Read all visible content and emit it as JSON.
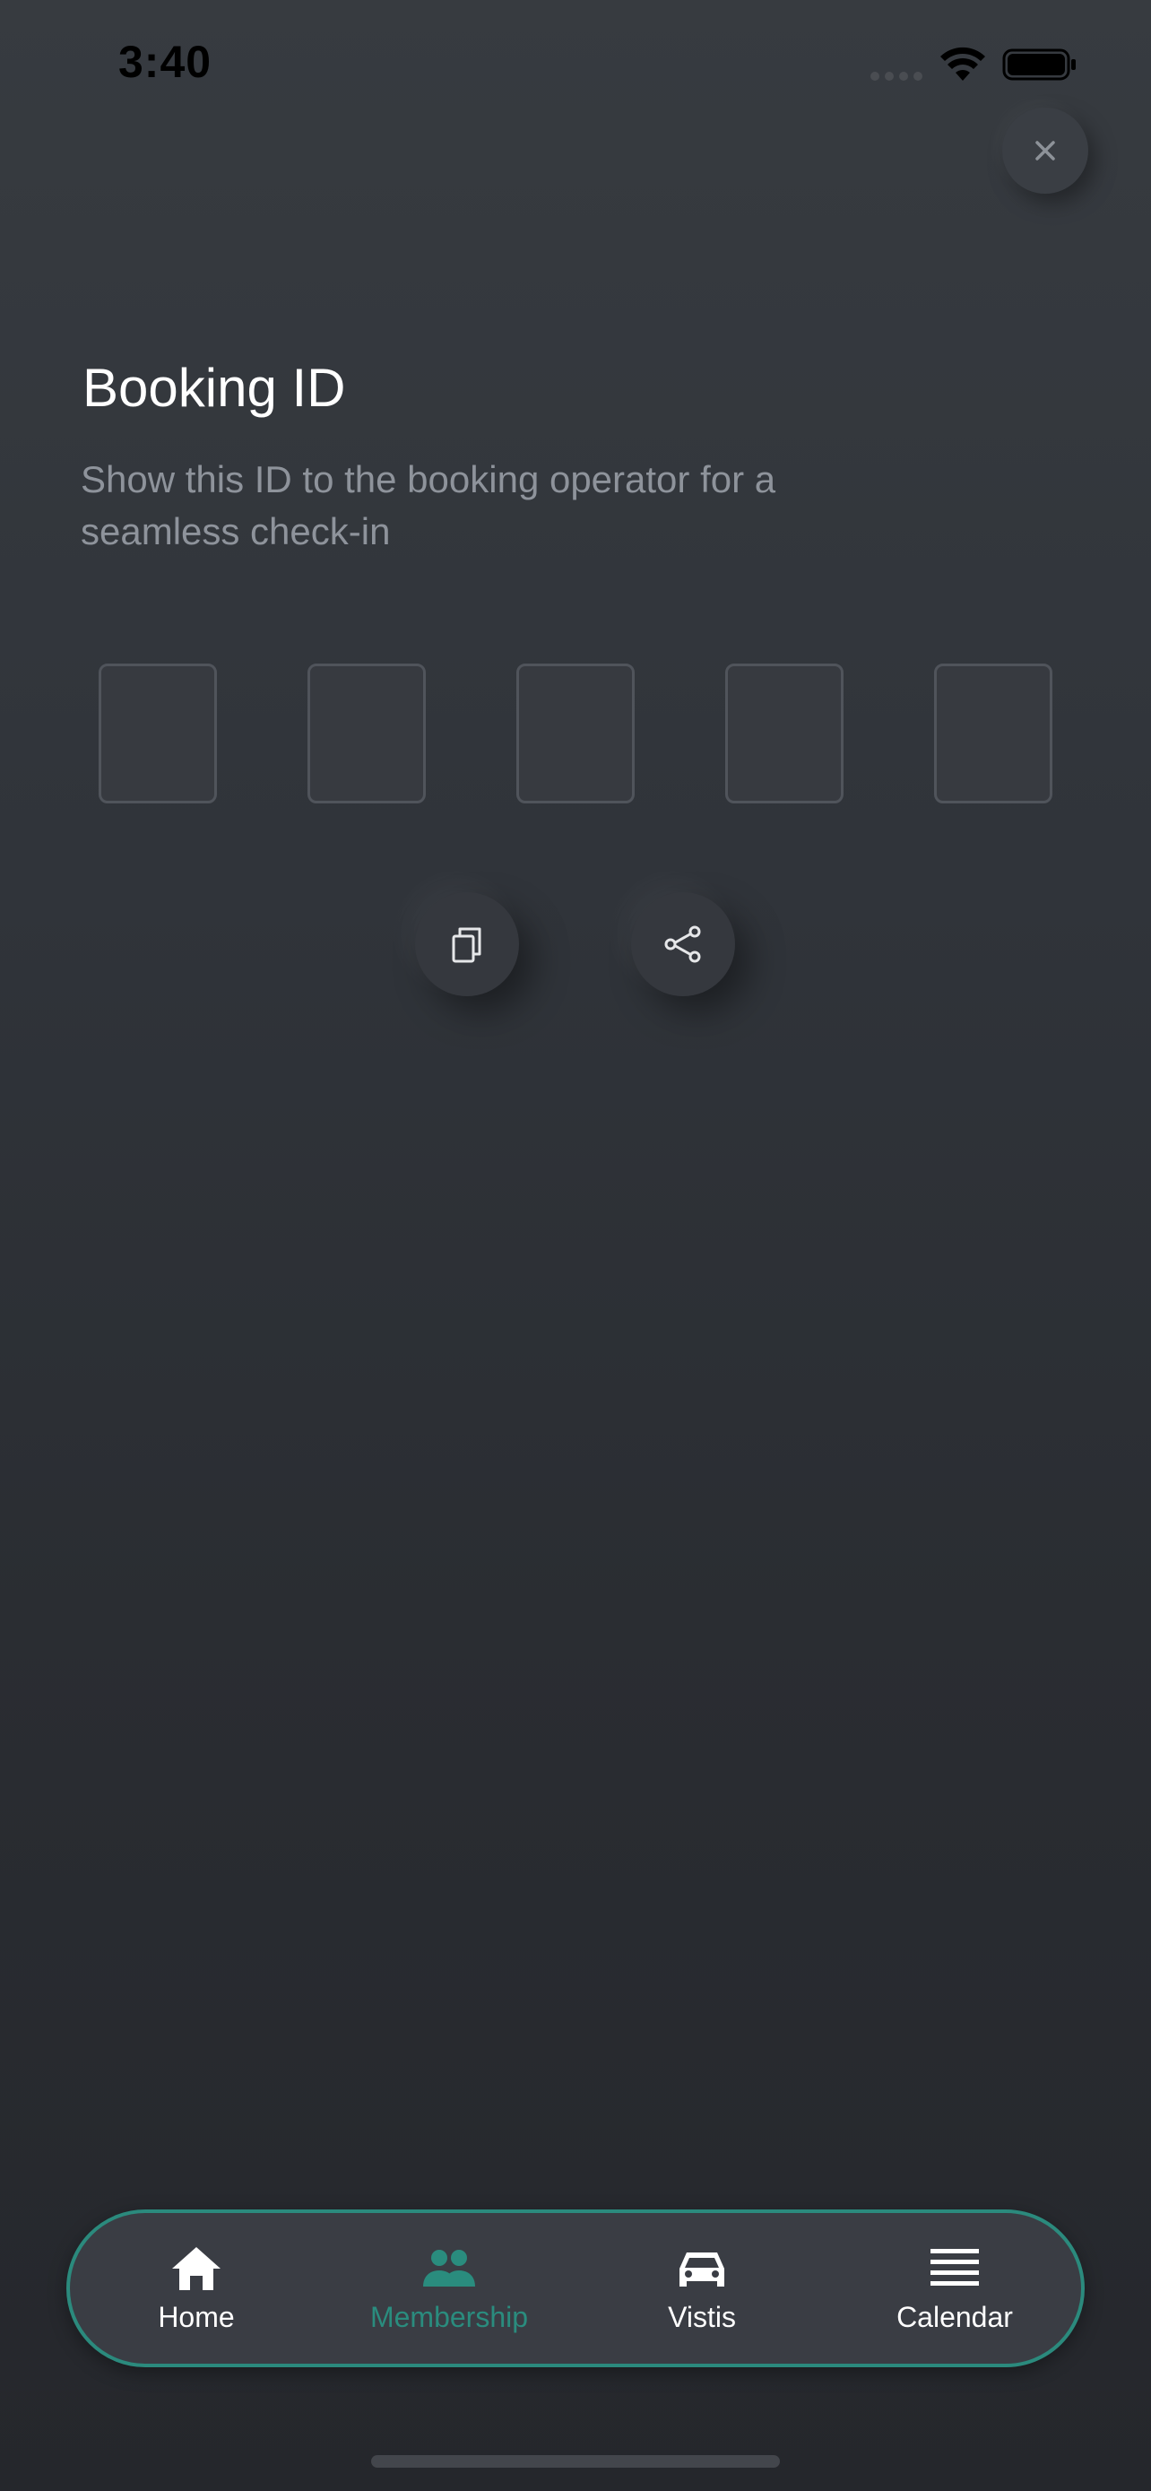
{
  "status_bar": {
    "time": "3:40"
  },
  "header": {
    "title": "Booking ID",
    "subtitle": "Show this ID to the booking operator for a seamless check-in"
  },
  "booking_id": {
    "digits": [
      "",
      "",
      "",
      "",
      ""
    ]
  },
  "actions": {
    "copy_icon": "copy-icon",
    "share_icon": "share-icon"
  },
  "bottom_nav": {
    "items": [
      {
        "label": "Home",
        "icon": "home-icon",
        "active": false
      },
      {
        "label": "Membership",
        "icon": "people-icon",
        "active": true
      },
      {
        "label": "Vistis",
        "icon": "car-icon",
        "active": false
      },
      {
        "label": "Calendar",
        "icon": "menu-lines-icon",
        "active": false
      }
    ]
  },
  "colors": {
    "accent": "#2a8c7e",
    "background_top": "#373b40",
    "background_bottom": "#25272c",
    "subtitle": "#8e939b"
  }
}
